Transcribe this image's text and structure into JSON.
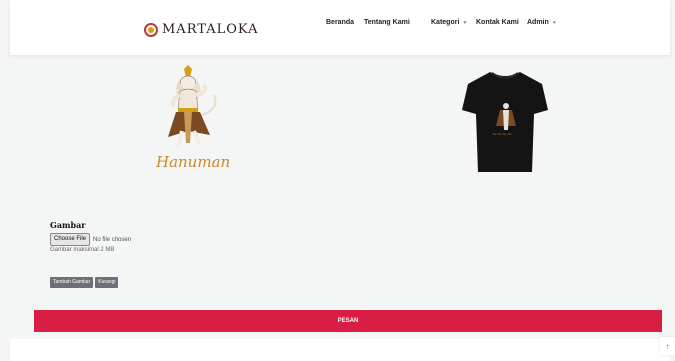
{
  "brand": {
    "name": "MARTALOKA",
    "logo_icon": "martaloka-logo-icon"
  },
  "nav": {
    "items": [
      {
        "label": "Beranda",
        "has_dropdown": false
      },
      {
        "label": "Tentang Kami",
        "has_dropdown": false
      },
      {
        "label": "Kategori",
        "has_dropdown": true
      },
      {
        "label": "Kontak Kami",
        "has_dropdown": false
      },
      {
        "label": "Admin",
        "has_dropdown": true
      }
    ],
    "caret_icon": "chevron-down-icon"
  },
  "product": {
    "design_caption": "Hanuman",
    "design_image": "hanuman-illustration",
    "shirt_image": "black-tshirt-mockup"
  },
  "form": {
    "image_label": "Gambar",
    "file_button": "Choose File",
    "file_status": "No file chosen",
    "file_hint": "Gambar maksimal 2 MB",
    "add_image_button": "Tambah Gambar",
    "remove_button": "Kurangi",
    "submit_button": "PESAN"
  },
  "scroll_top_icon": "arrow-up-icon",
  "colors": {
    "accent": "#d81e44",
    "muted_button": "#6b7078",
    "page_bg": "#f3f6f5"
  }
}
